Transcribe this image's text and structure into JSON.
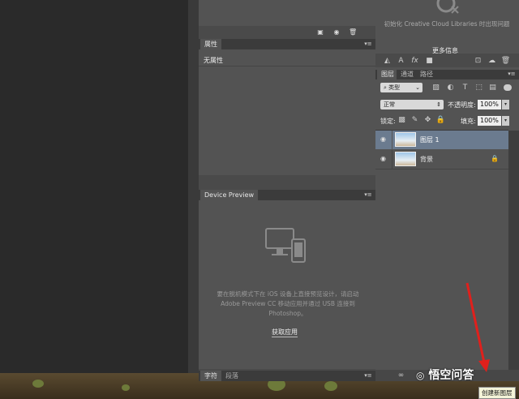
{
  "window": {
    "title": ""
  },
  "libraries": {
    "message": "初始化 Creative Cloud Libraries 时出现问题",
    "more_info": "更多信息"
  },
  "properties_panel": {
    "tab_label": "属性",
    "body_text": "无属性"
  },
  "device_preview": {
    "tab_label": "Device Preview",
    "message": "要在脱机模式下在 iOS 设备上直接预览设计，请启动 Adobe Preview CC 移动应用并通过 USB 连接到 Photoshop。",
    "get_app_label": "获取应用"
  },
  "bottom_tabs": [
    {
      "label": "字符"
    },
    {
      "label": "段落"
    }
  ],
  "layers_panel": {
    "tabs": [
      {
        "label": "图层"
      },
      {
        "label": "通道"
      },
      {
        "label": "路径"
      }
    ],
    "filter_label": "类型",
    "blend_mode": "正常",
    "opacity_label": "不透明度:",
    "opacity_value": "100%",
    "lock_label": "锁定:",
    "fill_label": "填充:",
    "fill_value": "100%",
    "layers": [
      {
        "name": "图层 1",
        "selected": true
      },
      {
        "name": "背景",
        "locked": true
      }
    ]
  },
  "tooltip": {
    "text": "创建新图层"
  },
  "watermark": {
    "text": "悟空问答"
  },
  "colors": {
    "panel": "#535353",
    "selection": "#6b7b8f",
    "annotation_arrow": "#e0201c"
  }
}
